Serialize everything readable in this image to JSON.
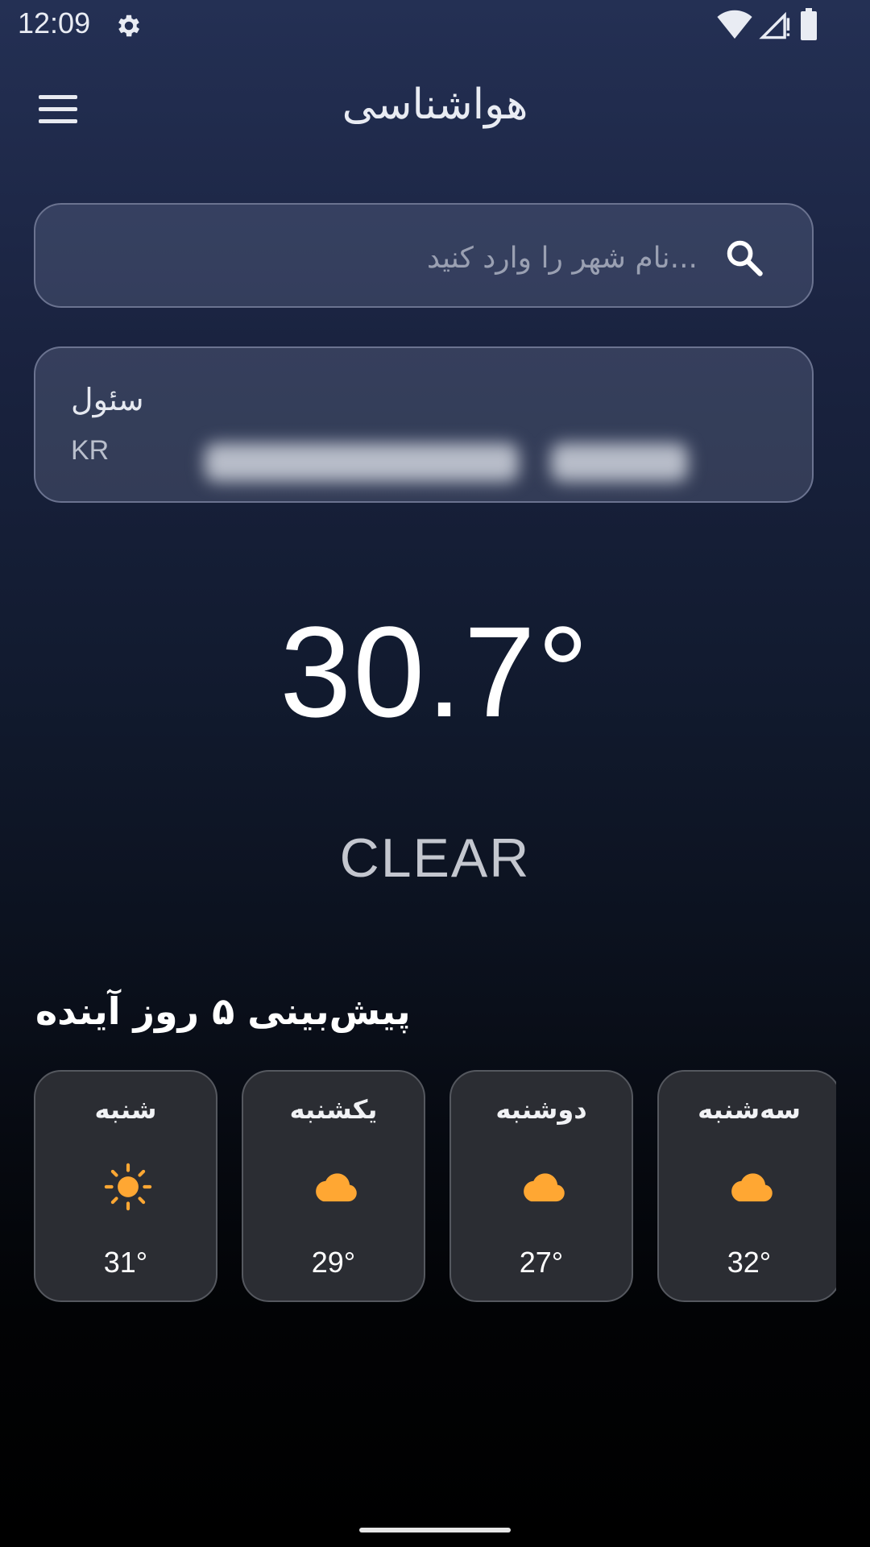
{
  "status_bar": {
    "time": "12:09",
    "icons": [
      "settings-icon",
      "wifi-icon",
      "signal-icon",
      "battery-icon"
    ]
  },
  "app_bar": {
    "title": "هواشناسی",
    "menu_icon": "menu-icon"
  },
  "search": {
    "placeholder": "...نام شهر را وارد کنید",
    "value": "",
    "icon": "search-icon"
  },
  "current": {
    "city": "سئول",
    "country": "KR",
    "temperature": "30.7°",
    "condition": "CLEAR"
  },
  "forecast": {
    "title": "پیش‌بینی ۵ روز آینده",
    "days": [
      {
        "day": "شنبه",
        "icon": "sun-icon",
        "temp": "31°"
      },
      {
        "day": "یکشنبه",
        "icon": "cloud-icon",
        "temp": "29°"
      },
      {
        "day": "دوشنبه",
        "icon": "cloud-icon",
        "temp": "27°"
      },
      {
        "day": "سه‌شنبه",
        "icon": "cloud-icon",
        "temp": "32°"
      }
    ]
  },
  "colors": {
    "accent": "#FFA733",
    "background_top": "#243054",
    "background_bottom": "#000000",
    "card": "#2B2D33"
  }
}
